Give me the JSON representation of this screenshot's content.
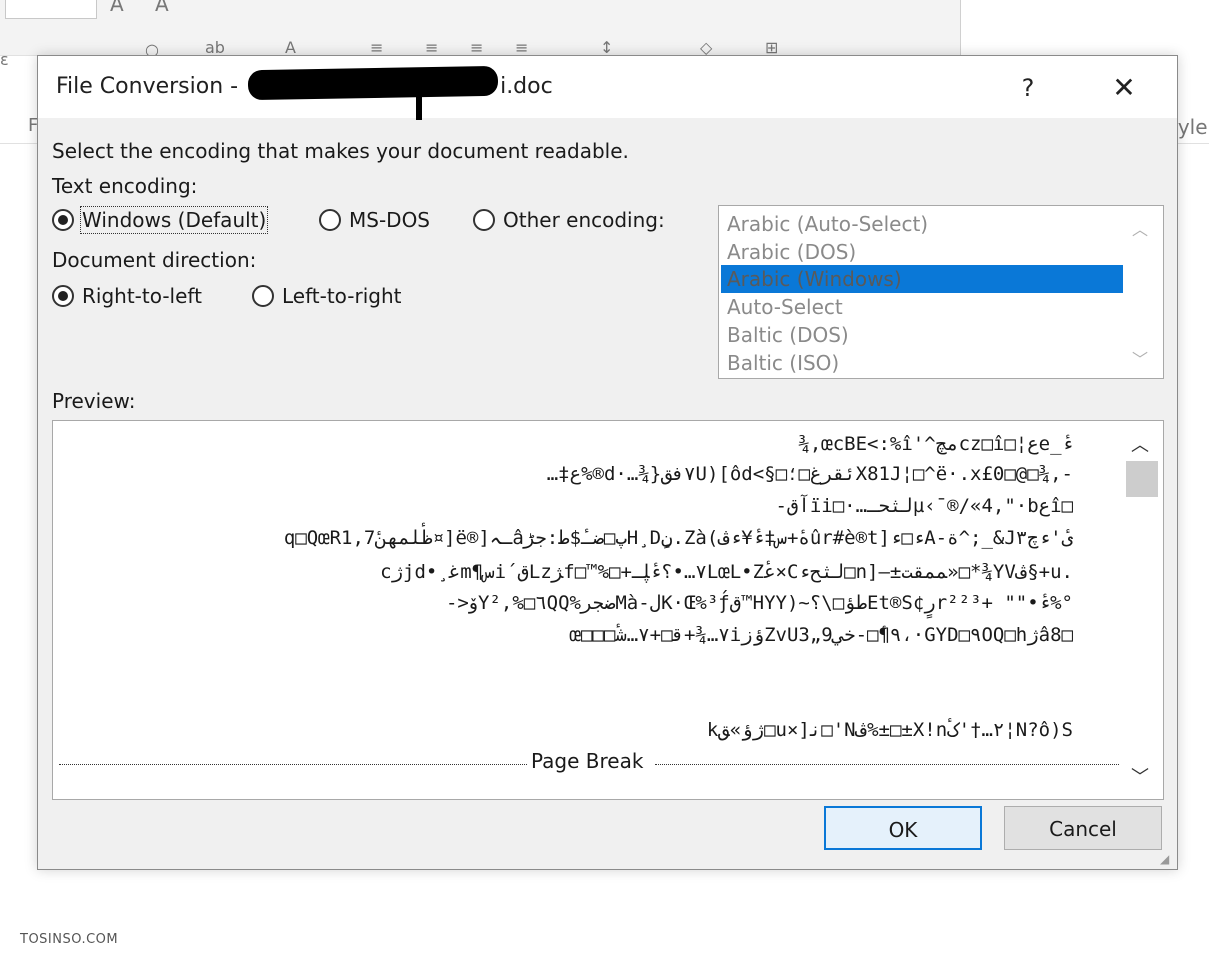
{
  "dialog": {
    "title": "File Conversion - ",
    "title_suffix": "i.doc",
    "help": "?",
    "close": "✕",
    "instruction": "Select the encoding that makes your document readable.",
    "text_encoding_label": "Text encoding:",
    "encoding_options": {
      "windows": "Windows (Default)",
      "msdos": "MS-DOS",
      "other": "Other encoding:"
    },
    "selected_encoding_option": "windows",
    "direction_label": "Document direction:",
    "direction_options": {
      "rtl": "Right-to-left",
      "ltr": "Left-to-right"
    },
    "selected_direction": "rtl",
    "encoding_list": [
      "Arabic (Auto-Select)",
      "Arabic (DOS)",
      "Arabic (Windows)",
      "Auto-Select",
      "Baltic (DOS)",
      "Baltic (ISO)"
    ],
    "encoding_list_selected": "Arabic (Windows)",
    "preview_label": "Preview:",
    "preview_lines": [
      "¾,œcBE<:%î'^مچcz□î□¦عe_ءٔ",
      "…‡ع%®d·…¾}٧فقU)[ôd<§□ئقرغ□؛X81J¦□^ë·.x£0□@□¾,-",
      "-آقïi□·…لثحـµ‹¯®/«4,\"·bعî□",
      "q□QœRظٔلمهنٔ1,7¤]ë®]ـہâپ□ضـٔ$ط:جڑH¸Dٍن.Zà(هٔ+س‡ءٔ¥ءڤûr#è®t]ء□ءA-ة^;_&Jىٔ'ءچ٣",
      "cژjd•¸غ‍m¶سi´قL‍z‍ژf□™%□+٧…•؟ءٔ‍ڸـLœL•Zعٔ‍×Cلثحء□n]–‍±‍م‍مقت»□*¾YVڤ§+u.",
      "->ۆY²,%□٦QQ%ض‍جرMà-لK·Œ%³ƒ́ق™HYY)~طؤ‍□\\؟Et®S¢رٍ‍r‍²²³+ \"\"•ءٔ%‍°",
      "œ□□□٧…¾+ق‍□+٧…شٔ‍iؤزZvU3„9٩‍¶ٔ‍□-خي،·GYD□٩OQ‍□‍‍hژâ8□",
      "kژؤ»‍ق□u×]ن‍□'Nڤ%±□±X!n٢…†'کٔ¦N?ô)S"
    ],
    "page_break": "Page Break",
    "ok": "OK",
    "cancel": "Cancel"
  },
  "watermark": "TOSINSO.COM",
  "background": {
    "styles_fragment": "tyle",
    "f_fragment": "F"
  },
  "colors": {
    "accent": "#0a78d7",
    "dialog_bg": "#f0f0f0"
  }
}
